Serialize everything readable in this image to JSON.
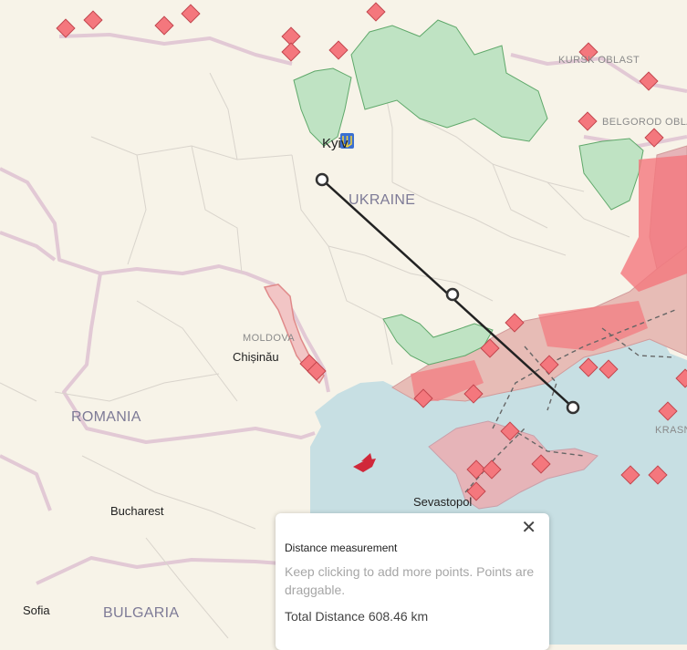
{
  "map": {
    "countries": [
      "UKRAINE",
      "ROMANIA",
      "BULGARIA",
      "MOLDOVA"
    ],
    "regions": [
      "KURSK OBLAST",
      "BELGOROD OBLAST",
      "KRASN"
    ],
    "cities": [
      "Kyiv",
      "Chișinău",
      "Bucharest",
      "Sofia",
      "Sevastopol"
    ],
    "colors": {
      "land": "#f7f3e8",
      "sea": "#c7dfe3",
      "russian_occupied": "#e6b4b8",
      "liberated": "#bfe3c3",
      "transnistria": "#f2c5c5",
      "marker": "#f4777d",
      "measure_line": "#222222"
    }
  },
  "measurement": {
    "title": "Distance measurement",
    "hint": "Keep clicking to add more points. Points are draggable.",
    "total_label": "Total Distance",
    "total_value": "608.46 km"
  }
}
